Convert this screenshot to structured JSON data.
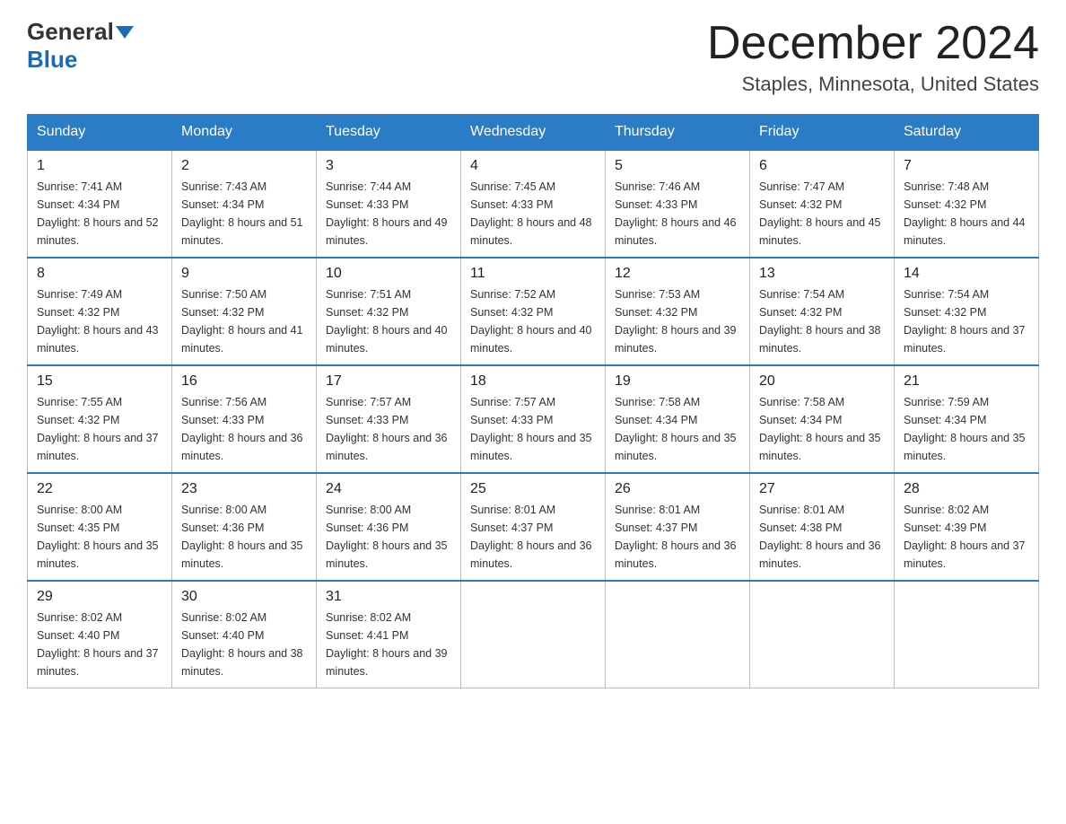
{
  "header": {
    "logo_general": "General",
    "logo_blue": "Blue",
    "month_title": "December 2024",
    "location": "Staples, Minnesota, United States"
  },
  "days_of_week": [
    "Sunday",
    "Monday",
    "Tuesday",
    "Wednesday",
    "Thursday",
    "Friday",
    "Saturday"
  ],
  "weeks": [
    [
      {
        "day": "1",
        "sunrise": "7:41 AM",
        "sunset": "4:34 PM",
        "daylight": "8 hours and 52 minutes."
      },
      {
        "day": "2",
        "sunrise": "7:43 AM",
        "sunset": "4:34 PM",
        "daylight": "8 hours and 51 minutes."
      },
      {
        "day": "3",
        "sunrise": "7:44 AM",
        "sunset": "4:33 PM",
        "daylight": "8 hours and 49 minutes."
      },
      {
        "day": "4",
        "sunrise": "7:45 AM",
        "sunset": "4:33 PM",
        "daylight": "8 hours and 48 minutes."
      },
      {
        "day": "5",
        "sunrise": "7:46 AM",
        "sunset": "4:33 PM",
        "daylight": "8 hours and 46 minutes."
      },
      {
        "day": "6",
        "sunrise": "7:47 AM",
        "sunset": "4:32 PM",
        "daylight": "8 hours and 45 minutes."
      },
      {
        "day": "7",
        "sunrise": "7:48 AM",
        "sunset": "4:32 PM",
        "daylight": "8 hours and 44 minutes."
      }
    ],
    [
      {
        "day": "8",
        "sunrise": "7:49 AM",
        "sunset": "4:32 PM",
        "daylight": "8 hours and 43 minutes."
      },
      {
        "day": "9",
        "sunrise": "7:50 AM",
        "sunset": "4:32 PM",
        "daylight": "8 hours and 41 minutes."
      },
      {
        "day": "10",
        "sunrise": "7:51 AM",
        "sunset": "4:32 PM",
        "daylight": "8 hours and 40 minutes."
      },
      {
        "day": "11",
        "sunrise": "7:52 AM",
        "sunset": "4:32 PM",
        "daylight": "8 hours and 40 minutes."
      },
      {
        "day": "12",
        "sunrise": "7:53 AM",
        "sunset": "4:32 PM",
        "daylight": "8 hours and 39 minutes."
      },
      {
        "day": "13",
        "sunrise": "7:54 AM",
        "sunset": "4:32 PM",
        "daylight": "8 hours and 38 minutes."
      },
      {
        "day": "14",
        "sunrise": "7:54 AM",
        "sunset": "4:32 PM",
        "daylight": "8 hours and 37 minutes."
      }
    ],
    [
      {
        "day": "15",
        "sunrise": "7:55 AM",
        "sunset": "4:32 PM",
        "daylight": "8 hours and 37 minutes."
      },
      {
        "day": "16",
        "sunrise": "7:56 AM",
        "sunset": "4:33 PM",
        "daylight": "8 hours and 36 minutes."
      },
      {
        "day": "17",
        "sunrise": "7:57 AM",
        "sunset": "4:33 PM",
        "daylight": "8 hours and 36 minutes."
      },
      {
        "day": "18",
        "sunrise": "7:57 AM",
        "sunset": "4:33 PM",
        "daylight": "8 hours and 35 minutes."
      },
      {
        "day": "19",
        "sunrise": "7:58 AM",
        "sunset": "4:34 PM",
        "daylight": "8 hours and 35 minutes."
      },
      {
        "day": "20",
        "sunrise": "7:58 AM",
        "sunset": "4:34 PM",
        "daylight": "8 hours and 35 minutes."
      },
      {
        "day": "21",
        "sunrise": "7:59 AM",
        "sunset": "4:34 PM",
        "daylight": "8 hours and 35 minutes."
      }
    ],
    [
      {
        "day": "22",
        "sunrise": "8:00 AM",
        "sunset": "4:35 PM",
        "daylight": "8 hours and 35 minutes."
      },
      {
        "day": "23",
        "sunrise": "8:00 AM",
        "sunset": "4:36 PM",
        "daylight": "8 hours and 35 minutes."
      },
      {
        "day": "24",
        "sunrise": "8:00 AM",
        "sunset": "4:36 PM",
        "daylight": "8 hours and 35 minutes."
      },
      {
        "day": "25",
        "sunrise": "8:01 AM",
        "sunset": "4:37 PM",
        "daylight": "8 hours and 36 minutes."
      },
      {
        "day": "26",
        "sunrise": "8:01 AM",
        "sunset": "4:37 PM",
        "daylight": "8 hours and 36 minutes."
      },
      {
        "day": "27",
        "sunrise": "8:01 AM",
        "sunset": "4:38 PM",
        "daylight": "8 hours and 36 minutes."
      },
      {
        "day": "28",
        "sunrise": "8:02 AM",
        "sunset": "4:39 PM",
        "daylight": "8 hours and 37 minutes."
      }
    ],
    [
      {
        "day": "29",
        "sunrise": "8:02 AM",
        "sunset": "4:40 PM",
        "daylight": "8 hours and 37 minutes."
      },
      {
        "day": "30",
        "sunrise": "8:02 AM",
        "sunset": "4:40 PM",
        "daylight": "8 hours and 38 minutes."
      },
      {
        "day": "31",
        "sunrise": "8:02 AM",
        "sunset": "4:41 PM",
        "daylight": "8 hours and 39 minutes."
      },
      null,
      null,
      null,
      null
    ]
  ]
}
